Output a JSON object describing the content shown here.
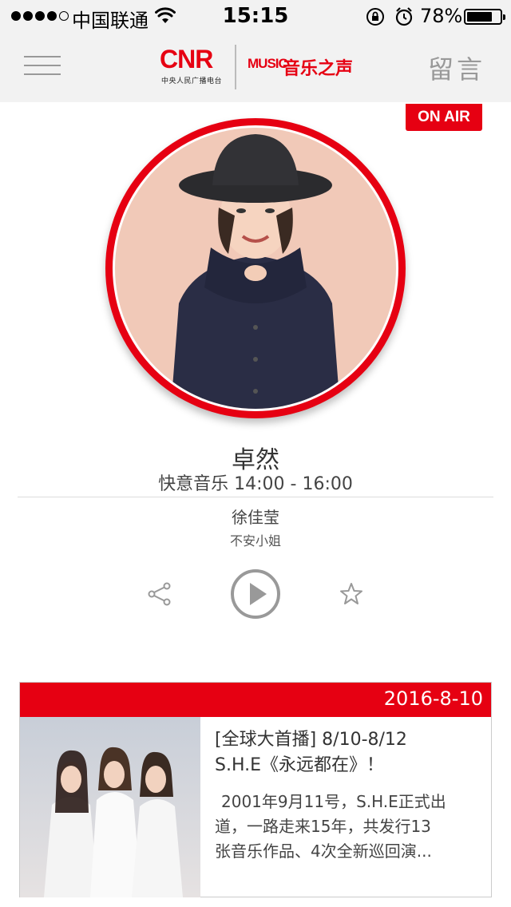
{
  "status_bar": {
    "carrier": "中国联通",
    "time": "15:15",
    "battery_percent": "78%",
    "battery_level": 0.78,
    "signal_bars_filled": 4,
    "signal_bars_total": 5
  },
  "header": {
    "logo_cnr": "CNR",
    "logo_cnr_sub": "中央人民广播电台",
    "logo_music": "MUSIC",
    "logo_music_cn": "音乐之声",
    "message_label": "留言"
  },
  "live": {
    "badge": "ON AIR",
    "host_name": "卓然",
    "program": "快意音乐 14:00 - 16:00",
    "artist": "徐佳莹",
    "song": "不安小姐"
  },
  "controls": {
    "share_icon": "share-icon",
    "play_icon": "play-icon",
    "favorite_icon": "star-icon"
  },
  "news": {
    "date": "2016-8-10",
    "title_line1": "[全球大首播] 8/10-8/12",
    "title_line2": "S.H.E《永远都在》！",
    "summary_line1": "2001年9月11号，S.H.E正式出",
    "summary_line2": "道，一路走来15年，共发行13",
    "summary_line3": "张音乐作品、4次全新巡回演..."
  },
  "colors": {
    "brand_red": "#e60012",
    "header_bg": "#f2f2f2",
    "icon_gray": "#999999"
  }
}
